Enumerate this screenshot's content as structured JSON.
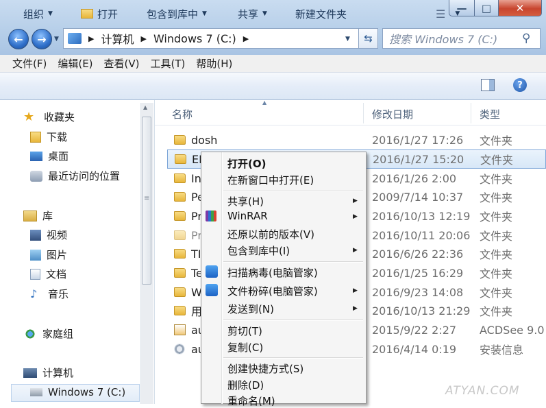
{
  "address": {
    "path": [
      "计算机",
      "Windows 7 (C:)"
    ]
  },
  "search": {
    "placeholder": "搜索 Windows 7 (C:)"
  },
  "menubar": [
    "文件(F)",
    "编辑(E)",
    "查看(V)",
    "工具(T)",
    "帮助(H)"
  ],
  "toolbar": {
    "organize": "组织",
    "open": "打开",
    "include": "包含到库中",
    "share": "共享",
    "new_folder": "新建文件夹"
  },
  "nav": {
    "favorites": "收藏夹",
    "fav_items": [
      "下载",
      "桌面",
      "最近访问的位置"
    ],
    "libraries": "库",
    "lib_items": [
      "视频",
      "图片",
      "文档",
      "音乐"
    ],
    "homegroup": "家庭组",
    "computer": "计算机",
    "drive": "Windows 7 (C:)"
  },
  "columns": {
    "name": "名称",
    "date": "修改日期",
    "type": "类型"
  },
  "files": [
    {
      "name": "dosh",
      "date": "2016/1/27 17:26",
      "type": "文件夹"
    },
    {
      "name": "EF",
      "date": "2016/1/27 15:20",
      "type": "文件夹"
    },
    {
      "name": "In",
      "date": "2016/1/26 2:00",
      "type": "文件夹"
    },
    {
      "name": "Pe",
      "date": "2009/7/14 10:37",
      "type": "文件夹"
    },
    {
      "name": "Pr",
      "date": "2016/10/13 12:19",
      "type": "文件夹"
    },
    {
      "name": "Pr",
      "date": "2016/10/11 20:06",
      "type": "文件夹"
    },
    {
      "name": "TI",
      "date": "2016/6/26 22:36",
      "type": "文件夹"
    },
    {
      "name": "Te",
      "date": "2016/1/25 16:29",
      "type": "文件夹"
    },
    {
      "name": "W",
      "date": "2016/9/23 14:08",
      "type": "文件夹"
    },
    {
      "name": "用",
      "date": "2016/10/13 21:29",
      "type": "文件夹"
    },
    {
      "name": "au",
      "date": "2015/9/22 2:27",
      "type": "ACDSee 9.0"
    },
    {
      "name": "au",
      "date": "2016/4/14 0:19",
      "type": "安装信息"
    }
  ],
  "context_menu": {
    "open": "打开(O)",
    "open_new_window": "在新窗口中打开(E)",
    "share": "共享(H)",
    "winrar": "WinRAR",
    "restore": "还原以前的版本(V)",
    "include": "包含到库中(I)",
    "scan": "扫描病毒(电脑管家)",
    "shred": "文件粉碎(电脑管家)",
    "send_to": "发送到(N)",
    "cut": "剪切(T)",
    "copy": "复制(C)",
    "shortcut": "创建快捷方式(S)",
    "delete": "删除(D)",
    "rename": "重命名(M)"
  },
  "watermark": "ATYAN.COM",
  "colors": {
    "accent": "#2f6fc9",
    "selection": "#d7e7f7",
    "close": "#c8452e"
  }
}
